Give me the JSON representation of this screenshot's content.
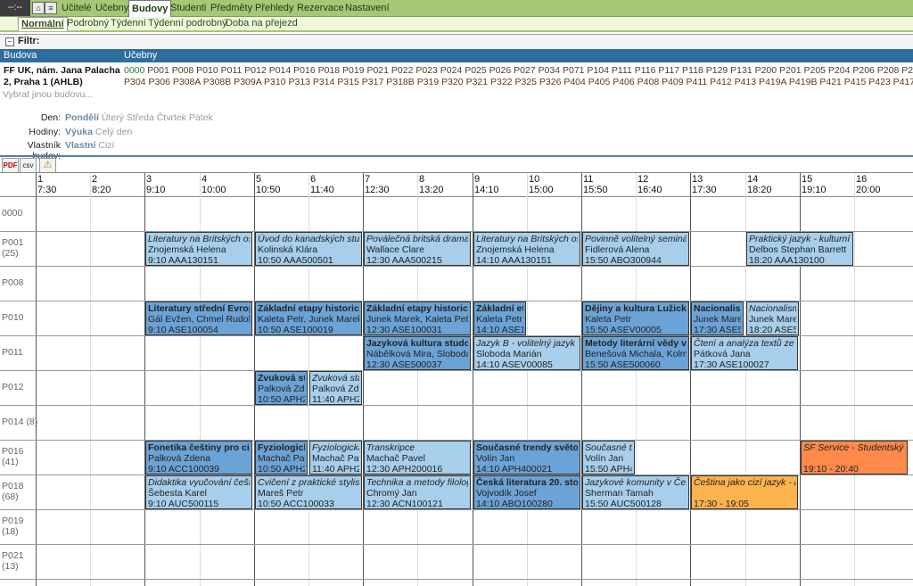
{
  "topnav": {
    "clock": "--:--",
    "menu": [
      "Učitelé",
      "Učebny",
      "Budovy",
      "Studenti",
      "Předměty",
      "Přehledy",
      "Rezervace",
      "Nastavení"
    ],
    "active_menu": "Budovy"
  },
  "subnav": {
    "items": [
      "Normální",
      "Podrobný",
      "Týdenní",
      "Týdenní podrobný",
      "Doba na přejezd"
    ]
  },
  "filter": {
    "label": "Filtr:"
  },
  "buildings": {
    "col_building": "Budova",
    "col_rooms": "Učebny",
    "name": "FF UK, nám. Jana Palacha 2, Praha 1 (AHLB)",
    "rooms_first": "0000",
    "rooms_line1": "P001 P008 P010 P011 P012 P014 P016 P018 P019 P021 P022 P023 P024 P025 P026 P027 P034 P071 P104 P111 P116 P117 P118 P129 P131 P200 P201 P205 P204 P206 P208 P209 P211 P",
    "rooms_line2": "P304 P306 P308A P308B P309A P310 P313 P314 P315 P317 P318B P319 P320 P321 P322 P325 P326 P404 P405 P406 P408 P409 P411 P412 P413 P419A P419B P421 P415 P423 P417 P429 P4",
    "other": "Vybrat jinou budovu..."
  },
  "filters": {
    "day": {
      "label": "Den:",
      "options": [
        "Pondělí",
        "Úterý",
        "Středa",
        "Čtvrtek",
        "Pátek"
      ],
      "selected": "Pondělí"
    },
    "hours": {
      "label": "Hodiny:",
      "options": [
        "Výuka",
        "Celý den"
      ],
      "selected": "Výuka"
    },
    "owner": {
      "label": "Vlastník budov:",
      "options": [
        "Vlastní",
        "Cizí"
      ],
      "selected": "Vlastní"
    }
  },
  "tools": [
    "pdf-icon",
    "csv",
    "warning-icon"
  ],
  "timeslots": [
    {
      "n": "1",
      "t": "7:30"
    },
    {
      "n": "2",
      "t": "8:20"
    },
    {
      "n": "3",
      "t": "9:10"
    },
    {
      "n": "4",
      "t": "10:00"
    },
    {
      "n": "5",
      "t": "10:50"
    },
    {
      "n": "6",
      "t": "11:40"
    },
    {
      "n": "7",
      "t": "12:30"
    },
    {
      "n": "8",
      "t": "13:20"
    },
    {
      "n": "9",
      "t": "14:10"
    },
    {
      "n": "10",
      "t": "15:00"
    },
    {
      "n": "11",
      "t": "15:50"
    },
    {
      "n": "12",
      "t": "16:40"
    },
    {
      "n": "13",
      "t": "17:30"
    },
    {
      "n": "14",
      "t": "18:20"
    },
    {
      "n": "15",
      "t": "19:10"
    },
    {
      "n": "16",
      "t": "20:00"
    }
  ],
  "rooms": [
    {
      "name": "0000",
      "cap": ""
    },
    {
      "name": "P001",
      "cap": "(25)"
    },
    {
      "name": "P008",
      "cap": ""
    },
    {
      "name": "P010",
      "cap": ""
    },
    {
      "name": "P011",
      "cap": ""
    },
    {
      "name": "P012",
      "cap": ""
    },
    {
      "name": "P014 (8)",
      "cap": ""
    },
    {
      "name": "P016",
      "cap": "(41)"
    },
    {
      "name": "P018",
      "cap": "(68)"
    },
    {
      "name": "P019",
      "cap": "(18)"
    },
    {
      "name": "P021",
      "cap": "(13)"
    }
  ],
  "colors": {
    "light": "#a7cfeb",
    "dark": "#6ba3d6",
    "orange": "#fd8a4b",
    "yellow": "#fdb34e",
    "nav": "#a5c776"
  },
  "events": [
    {
      "row": 1,
      "slot": 3,
      "span": 2,
      "style": "light",
      "title": "Literatury na Britských ostrovech",
      "person": "Znojemská Helena",
      "code": "9:10 AAA130151"
    },
    {
      "row": 1,
      "slot": 5,
      "span": 2,
      "style": "light",
      "title": "Úvod do kanadských studií",
      "person": "Kolinská Klára",
      "code": "10:50 AAA500501"
    },
    {
      "row": 1,
      "slot": 7,
      "span": 2,
      "style": "light",
      "title": "Poválečná britská dramatika",
      "person": "Wallace Clare",
      "code": "12:30 AAA500215"
    },
    {
      "row": 1,
      "slot": 9,
      "span": 2,
      "style": "light",
      "title": "Literatury na Britských ostrovech",
      "person": "Znojemská Helena",
      "code": "14:10 AAA130151"
    },
    {
      "row": 1,
      "slot": 11,
      "span": 2,
      "style": "light",
      "title": "Povinně volitelný seminář",
      "person": "Fidlerová Alena",
      "code": "15:50 ABO300944"
    },
    {
      "row": 1,
      "slot": 14,
      "span": 2,
      "style": "light",
      "title": "Praktický jazyk - kulturní",
      "person": "Delbos Stephan Barrett",
      "code": "18:20 AAA130100"
    },
    {
      "row": 3,
      "slot": 3,
      "span": 2,
      "style": "dark",
      "title": "Literatury střední Evropy",
      "person": "Gál Evžen, Chmel Rudolf",
      "code": "9:10 ASE100054"
    },
    {
      "row": 3,
      "slot": 5,
      "span": 2,
      "style": "dark",
      "title": "Základní etapy historického",
      "person": "Kaleta Petr, Junek Marek",
      "code": "10:50 ASE100019"
    },
    {
      "row": 3,
      "slot": 7,
      "span": 2,
      "style": "dark",
      "title": "Základní etapy historického",
      "person": "Junek Marek, Kaleta Petr",
      "code": "12:30 ASE100031"
    },
    {
      "row": 3,
      "slot": 9,
      "span": 1,
      "style": "dark",
      "title": "Základní etapy",
      "person": "Kaleta Petr",
      "code": "14:10 ASE1"
    },
    {
      "row": 3,
      "slot": 11,
      "span": 2,
      "style": "dark",
      "title": "Dějiny a kultura Lužických Srbů",
      "person": "Kaleta Petr",
      "code": "15:50 ASEV00005"
    },
    {
      "row": 3,
      "slot": 13,
      "span": 1,
      "style": "dark",
      "title": "Nacionalismus",
      "person": "Junek Marek",
      "code": "17:30 ASE5"
    },
    {
      "row": 3,
      "slot": 14,
      "span": 1,
      "style": "light",
      "title": "Nacionalismus",
      "person": "Junek Marek",
      "code": "18:20 ASE5"
    },
    {
      "row": 4,
      "slot": 7,
      "span": 2,
      "style": "dark",
      "title": "Jazyková kultura studovaného jazyka",
      "person": "Nábělková Mira, Slobodan",
      "code": "12:30 ASE500037"
    },
    {
      "row": 4,
      "slot": 9,
      "span": 2,
      "style": "light",
      "title": "Jazyk B - volitelný jazyk",
      "person": "Sloboda Marián",
      "code": "14:10 ASEV00085"
    },
    {
      "row": 4,
      "slot": 11,
      "span": 2,
      "style": "dark",
      "title": "Metody literární vědy ve",
      "person": "Benešová Michala, Kolmaš",
      "code": "15:50 ASE500060"
    },
    {
      "row": 4,
      "slot": 13,
      "span": 2,
      "style": "light",
      "title": "Čtení a analýza textů ze",
      "person": "Pátková Jana",
      "code": "17:30 ASE100027"
    },
    {
      "row": 5,
      "slot": 5,
      "span": 1,
      "style": "dark",
      "title": "Zvuková stavba",
      "person": "Palková Zdena",
      "code": "10:50 APH2"
    },
    {
      "row": 5,
      "slot": 6,
      "span": 1,
      "style": "light",
      "title": "Zvuková stavba",
      "person": "Palková Zdena",
      "code": "11:40 APH2"
    },
    {
      "row": 7,
      "slot": 3,
      "span": 2,
      "style": "dark",
      "title": "Fonetika češtiny pro cizince",
      "person": "Palková Zdena",
      "code": "9:10 ACC100039"
    },
    {
      "row": 7,
      "slot": 5,
      "span": 1,
      "style": "dark",
      "title": "Fyziologická",
      "person": "Machač Pavel",
      "code": "10:50 APH2"
    },
    {
      "row": 7,
      "slot": 6,
      "span": 1,
      "style": "light",
      "title": "Fyziologická",
      "person": "Machač Pavel",
      "code": "11:40 APH2"
    },
    {
      "row": 7,
      "slot": 7,
      "span": 2,
      "style": "light",
      "title": "Transkripce",
      "person": "Machač Pavel",
      "code": "12:30 APH200016"
    },
    {
      "row": 7,
      "slot": 9,
      "span": 2,
      "style": "dark",
      "title": "Současné trendy světové",
      "person": "Volín Jan",
      "code": "14:10 APH400021"
    },
    {
      "row": 7,
      "slot": 11,
      "span": 1,
      "style": "light",
      "title": "Současné trendy",
      "person": "Volín Jan",
      "code": "15:50 APH4"
    },
    {
      "row": 7,
      "slot": 15,
      "span": 2,
      "style": "orange",
      "title": "SF Service - Studentský fond",
      "person": "",
      "code": "19:10 - 20:40"
    },
    {
      "row": 8,
      "slot": 3,
      "span": 2,
      "style": "light",
      "title": "Didaktika vyučování češtiny",
      "person": "Šebesta Karel",
      "code": "9:10 AUC500115"
    },
    {
      "row": 8,
      "slot": 5,
      "span": 2,
      "style": "light",
      "title": "Cvičení z praktické stylistiky",
      "person": "Mareš Petr",
      "code": "10:50 ACC100033"
    },
    {
      "row": 8,
      "slot": 7,
      "span": 2,
      "style": "light",
      "title": "Technika a metody filologie",
      "person": "Chromý Jan",
      "code": "12:30 ACN100121"
    },
    {
      "row": 8,
      "slot": 9,
      "span": 2,
      "style": "dark",
      "title": "Česká literatura 20. století",
      "person": "Vojvodík Josef",
      "code": "14:10 ABO100280"
    },
    {
      "row": 8,
      "slot": 11,
      "span": 2,
      "style": "light",
      "title": "Jazykové komunity v Česku",
      "person": "Sherman Tamah",
      "code": "15:50 AUC500128"
    },
    {
      "row": 8,
      "slot": 13,
      "span": 2,
      "style": "yellow",
      "title": "Čeština jako cizí jazyk - nácvik",
      "person": "",
      "code": "17:30 - 19:05"
    }
  ]
}
